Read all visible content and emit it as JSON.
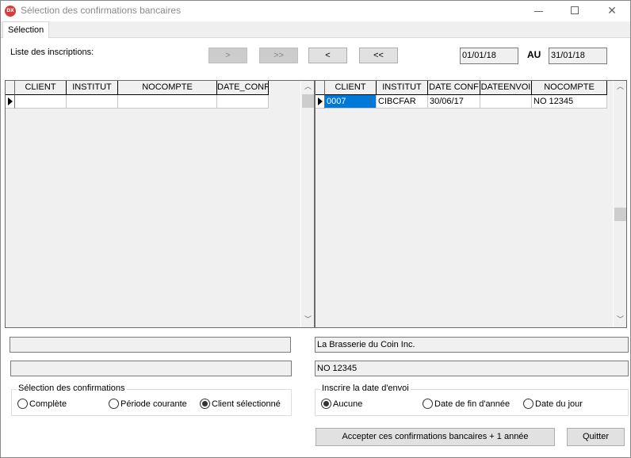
{
  "window": {
    "title": "Sélection des confirmations bancaires",
    "icon_text": "DX",
    "controls": {
      "minimize": "minimize-icon",
      "maximize": "maximize-icon",
      "close": "close-icon"
    }
  },
  "tabs": [
    {
      "label": "Sélection",
      "active": true
    }
  ],
  "header": {
    "list_label": "Liste des inscriptions:",
    "nav_buttons": [
      {
        "label": ">",
        "enabled": false
      },
      {
        "label": ">>",
        "enabled": false
      },
      {
        "label": "<",
        "enabled": true
      },
      {
        "label": "<<",
        "enabled": true
      }
    ],
    "date_from": "01/01/18",
    "date_separator": "AU",
    "date_to": "31/01/18"
  },
  "left_grid": {
    "columns": [
      "CLIENT",
      "INSTITUT",
      "NOCOMPTE",
      "DATE_CONF"
    ],
    "rows": [
      [
        "",
        "",
        "",
        ""
      ]
    ],
    "scroll_position": 0.0
  },
  "right_grid": {
    "columns": [
      "CLIENT",
      "INSTITUT",
      "DATE CONF",
      "DATEENVOI",
      "NOCOMPTE"
    ],
    "rows": [
      [
        "0007",
        "CIBCFAR",
        "30/06/17",
        "",
        "NO 12345"
      ]
    ],
    "selected_cell": {
      "row": 0,
      "column": 0
    },
    "scroll_position": 0.55
  },
  "info": {
    "left_field_1": "",
    "left_field_2": "",
    "client_name": "La Brasserie du Coin Inc.",
    "account_number": "NO 12345"
  },
  "selection_group": {
    "title": "Sélection des confirmations",
    "options": [
      {
        "label": "Complète",
        "checked": false
      },
      {
        "label": "Période courante",
        "checked": false
      },
      {
        "label": "Client sélectionné",
        "checked": true
      }
    ]
  },
  "send_date_group": {
    "title": "Inscrire la date d'envoi",
    "options": [
      {
        "label": "Aucune",
        "checked": true
      },
      {
        "label": "Date de fin d'année",
        "checked": false
      },
      {
        "label": "Date du jour",
        "checked": false
      }
    ]
  },
  "buttons": {
    "accept": "Accepter ces confirmations bancaires + 1 année",
    "quit": "Quitter"
  },
  "colors": {
    "selection": "#0078d7",
    "app_icon": "#d93a3a"
  }
}
